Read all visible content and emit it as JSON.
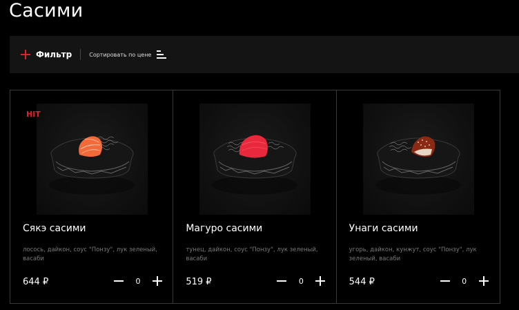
{
  "page": {
    "title": "Сасими"
  },
  "toolbar": {
    "filter_label": "Фильтр",
    "sort_label": "Сортировать по цене",
    "accent_color": "#e0202a"
  },
  "products": [
    {
      "badge": "HIT",
      "name": "Сякэ сасими",
      "description": "лосось, дайкон, соус \"Понзу\", лук зеленый, васаби",
      "price": "644 ₽",
      "quantity": "0",
      "fish_color": "#f26a3a"
    },
    {
      "badge": "",
      "name": "Магуро сасими",
      "description": "тунец, дайкон, соус \"Понзу\", лук зеленый, васаби",
      "price": "519 ₽",
      "quantity": "0",
      "fish_color": "#e8283c"
    },
    {
      "badge": "",
      "name": "Унаги сасими",
      "description": "угорь, дайкон, кунжут, соус \"Понзу\", лук зеленый, васаби",
      "price": "544 ₽",
      "quantity": "0",
      "fish_color": "#8a2a14"
    }
  ]
}
